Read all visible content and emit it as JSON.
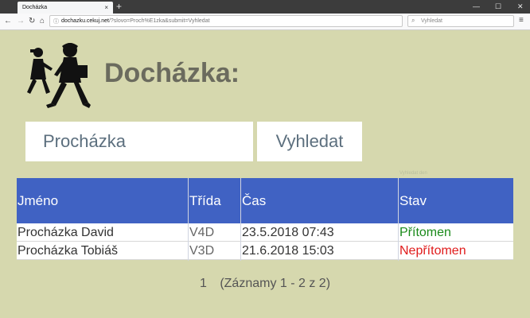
{
  "browser": {
    "tab_title": "Docházka",
    "tab_close": "×",
    "new_tab": "+",
    "url_domain": "dochazku.cekuj.net",
    "url_rest": "/?slovo=Proch%E1zka&submit=Vyhledat",
    "url_host_prefix": "dochazku.",
    "search_placeholder": "Vyhledat"
  },
  "page": {
    "title": "Docházka:",
    "search_value": "Procházka",
    "search_button": "Vyhledat",
    "faint_text": "Vyhledat den"
  },
  "table": {
    "headers": [
      "Jméno",
      "Třída",
      "Čas",
      "Stav"
    ],
    "rows": [
      {
        "name": "Procházka David",
        "class": "V4D",
        "time": "23.5.2018 07:43",
        "status": "Přítomen",
        "status_color": "#1a8a1a"
      },
      {
        "name": "Procházka Tobiáš",
        "class": "V3D",
        "time": "21.6.2018 15:03",
        "status": "Nepřítomen",
        "status_color": "#e01b1b"
      }
    ]
  },
  "pager": {
    "page": "1",
    "summary": "(Záznamy 1 - 2 z 2)"
  },
  "colors": {
    "background": "#d6d8ae",
    "header": "#4062c3",
    "title": "#6b6b5e"
  }
}
